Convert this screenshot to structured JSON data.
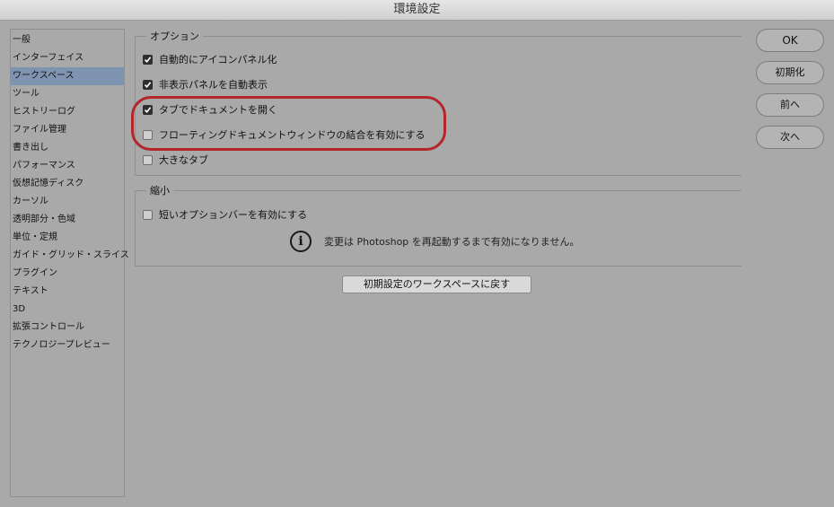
{
  "window": {
    "title": "環境設定"
  },
  "sidebar": {
    "items": [
      {
        "label": "一般",
        "selected": false
      },
      {
        "label": "インターフェイス",
        "selected": false
      },
      {
        "label": "ワークスペース",
        "selected": true
      },
      {
        "label": "ツール",
        "selected": false
      },
      {
        "label": "ヒストリーログ",
        "selected": false
      },
      {
        "label": "ファイル管理",
        "selected": false
      },
      {
        "label": "書き出し",
        "selected": false
      },
      {
        "label": "パフォーマンス",
        "selected": false
      },
      {
        "label": "仮想記憶ディスク",
        "selected": false
      },
      {
        "label": "カーソル",
        "selected": false
      },
      {
        "label": "透明部分・色域",
        "selected": false
      },
      {
        "label": "単位・定規",
        "selected": false
      },
      {
        "label": "ガイド・グリッド・スライス",
        "selected": false
      },
      {
        "label": "プラグイン",
        "selected": false
      },
      {
        "label": "テキスト",
        "selected": false
      },
      {
        "label": "3D",
        "selected": false
      },
      {
        "label": "拡張コントロール",
        "selected": false
      },
      {
        "label": "テクノロジープレビュー",
        "selected": false
      }
    ]
  },
  "options": {
    "legend": "オプション",
    "checkboxes": [
      {
        "label": "自動的にアイコンパネル化",
        "checked": true
      },
      {
        "label": "非表示パネルを自動表示",
        "checked": true
      },
      {
        "label": "タブでドキュメントを開く",
        "checked": true
      },
      {
        "label": "フローティングドキュメントウィンドウの結合を有効にする",
        "checked": false
      },
      {
        "label": "大きなタブ",
        "checked": false
      }
    ]
  },
  "shrink": {
    "legend": "縮小",
    "checkbox": {
      "label": "短いオプションバーを有効にする",
      "checked": false
    },
    "info_text": "変更は Photoshop を再起動するまで有効になりません。"
  },
  "reset_button": "初期設定のワークスペースに戻す",
  "buttons": {
    "ok": "OK",
    "init": "初期化",
    "prev": "前へ",
    "next": "次へ"
  },
  "colors": {
    "highlight": "#b3262b",
    "selection": "#7e94b0",
    "background": "#a9a9a9"
  }
}
